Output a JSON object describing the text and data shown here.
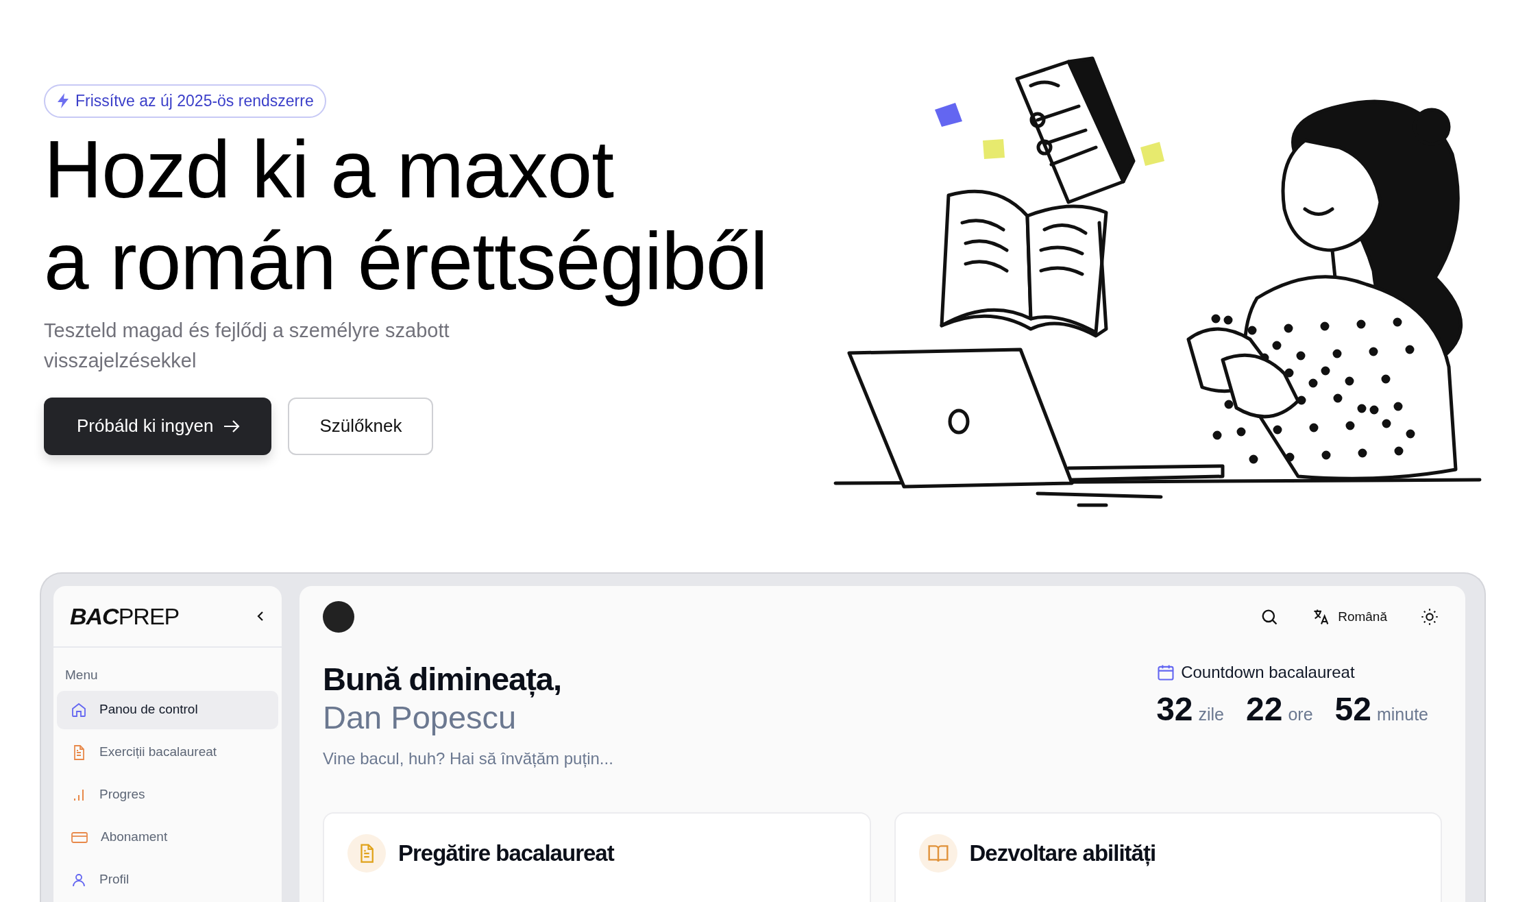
{
  "hero": {
    "badge": "Frissítve az új 2025-ös rendszerre",
    "title_lines": [
      "Hozd ki a maxot",
      "a román érettségiből"
    ],
    "subtitle": "Teszteld magad és fejlődj a személyre szabott visszajelzésekkel",
    "buttons": [
      {
        "label": "Próbáld ki ingyen",
        "kind": "primary"
      },
      {
        "label": "Szülőknek",
        "kind": "outline"
      }
    ]
  },
  "app": {
    "sidebar": {
      "logo_bold": "BAC",
      "logo_light": "PREP",
      "section": "Menu",
      "items": [
        {
          "label": "Panou de control",
          "kind": "home",
          "selected": true
        },
        {
          "label": "Exerciții bacalaureat",
          "kind": "document",
          "selected": false
        },
        {
          "label": "Progres",
          "kind": "chart",
          "selected": false
        },
        {
          "label": "Abonament",
          "kind": "card",
          "selected": false
        },
        {
          "label": "Profil",
          "kind": "user",
          "selected": false
        }
      ]
    },
    "topbar": {
      "language": "Română"
    },
    "greeting": "Bună dimineața,",
    "name": "Dan Popescu",
    "tagline": "Vine bacul, huh? Hai să învățăm puțin...",
    "countdown": {
      "title": "Countdown bacalaureat",
      "units": [
        {
          "value": "32",
          "unit": "zile"
        },
        {
          "value": "22",
          "unit": "ore"
        },
        {
          "value": "52",
          "unit": "minute"
        }
      ]
    },
    "cards": [
      {
        "title": "Pregătire bacalaureat",
        "kind": "document"
      },
      {
        "title": "Dezvoltare abilități",
        "kind": "book"
      }
    ]
  }
}
